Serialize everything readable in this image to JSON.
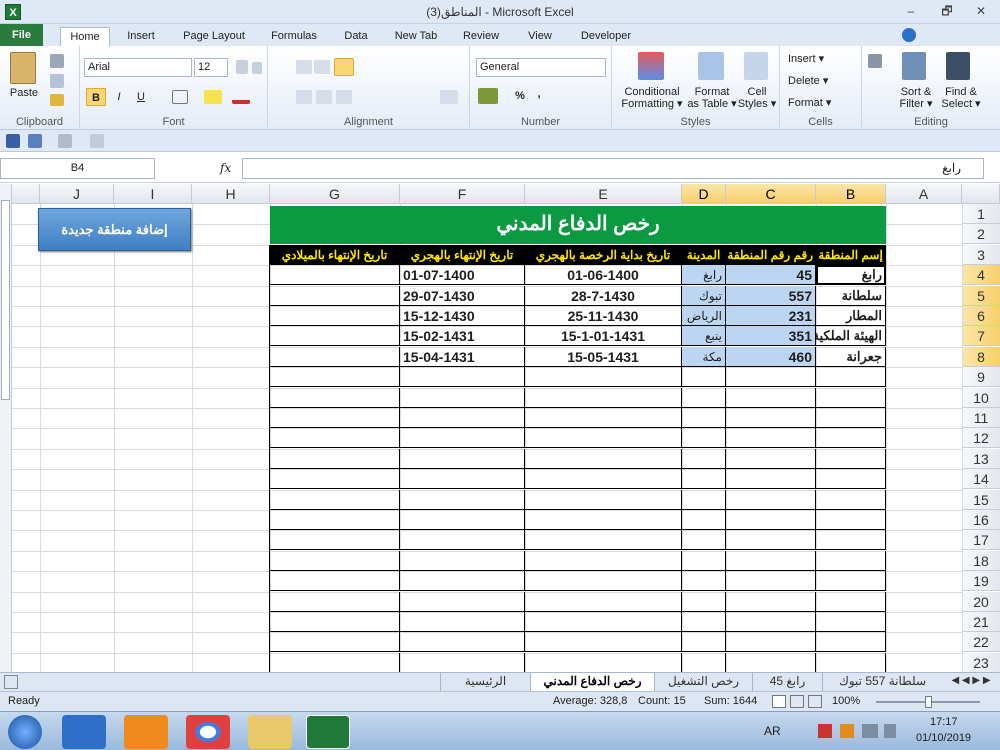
{
  "window": {
    "title": "(3)المناطق - Microsoft Excel",
    "minimize": "–",
    "restore": "🗗",
    "close": "✕",
    "app_icon": "X"
  },
  "tabs": [
    "File",
    "Home",
    "Insert",
    "Page Layout",
    "Formulas",
    "Data",
    "New Tab",
    "Review",
    "View",
    "Developer"
  ],
  "ribbon": {
    "clipboard": {
      "label": "Clipboard",
      "paste": "Paste"
    },
    "font": {
      "label": "Font",
      "name": "Arial",
      "size": "12",
      "bold": "B",
      "italic": "I",
      "underline": "U"
    },
    "alignment": {
      "label": "Alignment"
    },
    "number": {
      "label": "Number",
      "format": "General",
      "percent": "%",
      "comma": ","
    },
    "styles": {
      "label": "Styles",
      "conditional": "Conditional",
      "conditional2": "Formatting ▾",
      "format_as": "Format",
      "format_as2": "as Table ▾",
      "cell": "Cell",
      "cell2": "Styles ▾"
    },
    "cells": {
      "label": "Cells",
      "insert": "Insert ▾",
      "delete": "Delete ▾",
      "format": "Format ▾"
    },
    "editing": {
      "label": "Editing",
      "sort": "Sort &",
      "sort2": "Filter ▾",
      "find": "Find &",
      "find2": "Select ▾"
    }
  },
  "formula_bar": {
    "name_box": "B4",
    "fx": "fx",
    "content": "رابغ"
  },
  "columns": [
    "J",
    "I",
    "H",
    "G",
    "F",
    "E",
    "D",
    "C",
    "B",
    "A"
  ],
  "rows": [
    "1",
    "2",
    "3",
    "4",
    "5",
    "6",
    "7",
    "8",
    "9",
    "10",
    "11",
    "12",
    "13",
    "14",
    "15",
    "16",
    "17",
    "18",
    "19",
    "20",
    "21",
    "22",
    "23"
  ],
  "sheet": {
    "banner": "رخص الدفاع المدني",
    "add_button": "إضافة منطقة جديدة",
    "headers": {
      "b": "إسم المنطقة",
      "c": "رقم رقم المنطقة",
      "d": "المدينة",
      "e": "تاريخ بداية الرخصة بالهجري",
      "f": "تاريخ الإنتهاء بالهجري",
      "g": "تاريخ الإنتهاء بالميلادي"
    },
    "records": [
      {
        "b": "رابغ",
        "c": "45",
        "d": "رابغ",
        "e": "01-06-1400",
        "f": "01-07-1400"
      },
      {
        "b": "سلطانة",
        "c": "557",
        "d": "تبوك",
        "e": "28-7-1430",
        "f": "29-07-1430"
      },
      {
        "b": "المطار",
        "c": "231",
        "d": "الرياض",
        "e": "25-11-1430",
        "f": "15-12-1430"
      },
      {
        "b": "الهيئة الملكية",
        "c": "351",
        "d": "ينبع",
        "e": "15-1-01-1431",
        "f": "15-02-1431"
      },
      {
        "b": "جعرانة",
        "c": "460",
        "d": "مكة",
        "e": "15-05-1431",
        "f": "15-04-1431"
      }
    ]
  },
  "sheet_tabs": [
    "سلطانة 557 تبوك",
    "رابغ 45",
    "رخص التشغيل",
    "رخص الدفاع المدني",
    "الرئيسية"
  ],
  "status": {
    "ready": "Ready",
    "average": "Average: 328,8",
    "count": "Count: 15",
    "sum": "Sum: 1644",
    "zoom": "100%"
  },
  "taskbar": {
    "lang": "AR",
    "time": "17:17",
    "date": "01/10/2019"
  }
}
